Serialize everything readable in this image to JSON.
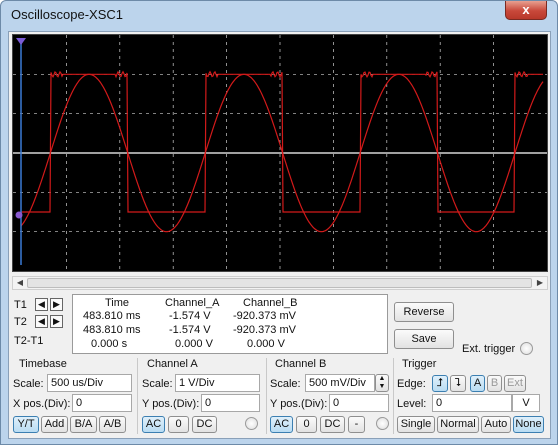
{
  "window": {
    "title": "Oscilloscope-XSC1",
    "close_glyph": "x"
  },
  "colors": {
    "screen_bg": "#000000",
    "trace_a": "#d21a1a",
    "trace_b": "#d21a1a",
    "grid": "#cfcfcf",
    "active_button": "#b9dcf2"
  },
  "cursors": {
    "t1_label": "T1",
    "t2_label": "T2",
    "t2t1_label": "T2-T1"
  },
  "readout": {
    "headers": [
      "Time",
      "Channel_A",
      "Channel_B"
    ],
    "rows": [
      [
        "483.810 ms",
        "-1.574 V",
        "-920.373 mV"
      ],
      [
        "483.810 ms",
        "-1.574 V",
        "-920.373 mV"
      ],
      [
        "0.000 s",
        "0.000 V",
        "0.000 V"
      ]
    ]
  },
  "buttons": {
    "reverse": "Reverse",
    "save": "Save",
    "ext_trigger": "Ext. trigger"
  },
  "timebase": {
    "title": "Timebase",
    "scale_label": "Scale:",
    "scale_value": "500 us/Div",
    "xpos_label": "X pos.(Div):",
    "xpos_value": "0",
    "modes": [
      "Y/T",
      "Add",
      "B/A",
      "A/B"
    ],
    "active_mode": "Y/T"
  },
  "channel_a": {
    "title": "Channel A",
    "scale_label": "Scale:",
    "scale_value": "1  V/Div",
    "ypos_label": "Y pos.(Div):",
    "ypos_value": "0",
    "coupling": [
      "AC",
      "0",
      "DC"
    ],
    "active_coupling": "AC"
  },
  "channel_b": {
    "title": "Channel B",
    "scale_label": "Scale:",
    "scale_value": "500 mV/Div",
    "ypos_label": "Y pos.(Div):",
    "ypos_value": "0",
    "coupling": [
      "AC",
      "0",
      "DC",
      "-"
    ],
    "active_coupling": "AC"
  },
  "trigger": {
    "title": "Trigger",
    "edge_label": "Edge:",
    "edge_sources": [
      "A",
      "B",
      "Ext"
    ],
    "active_source": "A",
    "level_label": "Level:",
    "level_value": "0",
    "level_unit": "V",
    "modes": [
      "Single",
      "Normal",
      "Auto",
      "None"
    ],
    "active_mode": "None"
  },
  "waveforms": {
    "sine_amplitude_div": 2.0,
    "square_high_div": 2.0,
    "square_low_div": -1.5,
    "period_div": 2.9,
    "phase_div": 0.55
  }
}
